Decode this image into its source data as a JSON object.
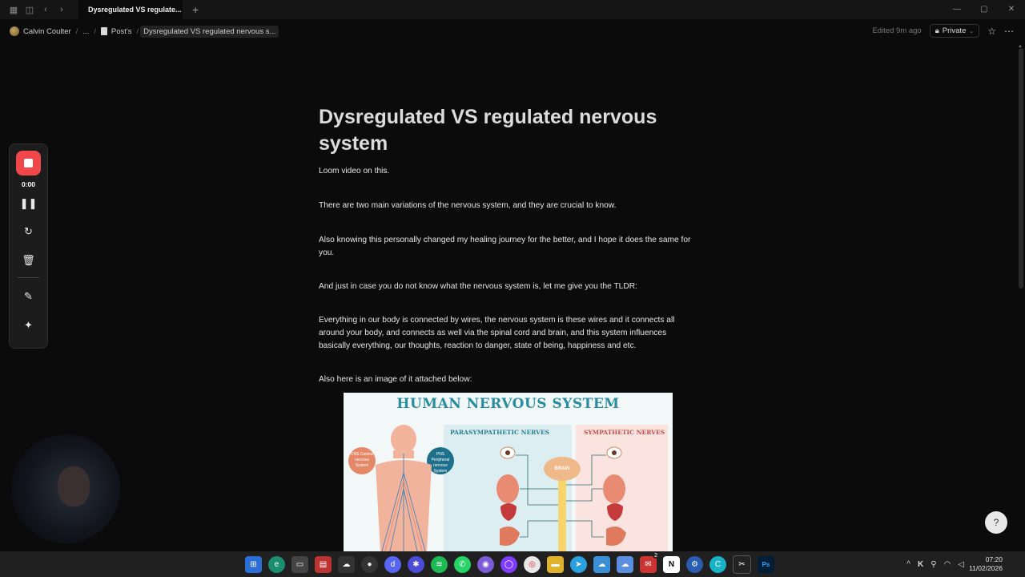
{
  "titlebar": {
    "tab_title": "Dysregulated VS regulate...",
    "new_tab": "+",
    "window_controls": [
      "—",
      "▢",
      "✕"
    ]
  },
  "breadcrumb": {
    "workspace": "Calvin Coulter",
    "ellipsis": "...",
    "parent": "Post's",
    "current": "Dysregulated VS regulated nervous s..."
  },
  "header_actions": {
    "edited": "Edited 9m ago",
    "privacy": "Private"
  },
  "page": {
    "title": "Dysregulated VS regulated nervous system",
    "paragraphs": [
      "Loom video on this.",
      "There are two main variations of the nervous system, and they are crucial to know.",
      "Also knowing this personally changed my healing journey for the better, and I hope it does the same for you.",
      "And just in case you do not know what the nervous system is, let me give you the TLDR:",
      "Everything in our body is connected by wires, the nervous system is these wires and it connects all around your body, and connects as well via the spinal cord and brain, and this system influences basically everything, our thoughts, reaction to danger, state of being, happiness and etc.",
      "Also here is an image of it attached below:"
    ]
  },
  "figure": {
    "title": "HUMAN NERVOUS SYSTEM",
    "parasympathetic": "PARASYMPATHETIC NERVES",
    "sympathetic": "SYMPATHETIC NERVES",
    "cns": "CNS Central nervous System",
    "pns": "PNS Peripheral nervous System",
    "brain": "BRAIN"
  },
  "recorder": {
    "time": "0:00"
  },
  "taskbar": {
    "time": "07:20",
    "date": "11/02/2026",
    "badge": "2"
  }
}
